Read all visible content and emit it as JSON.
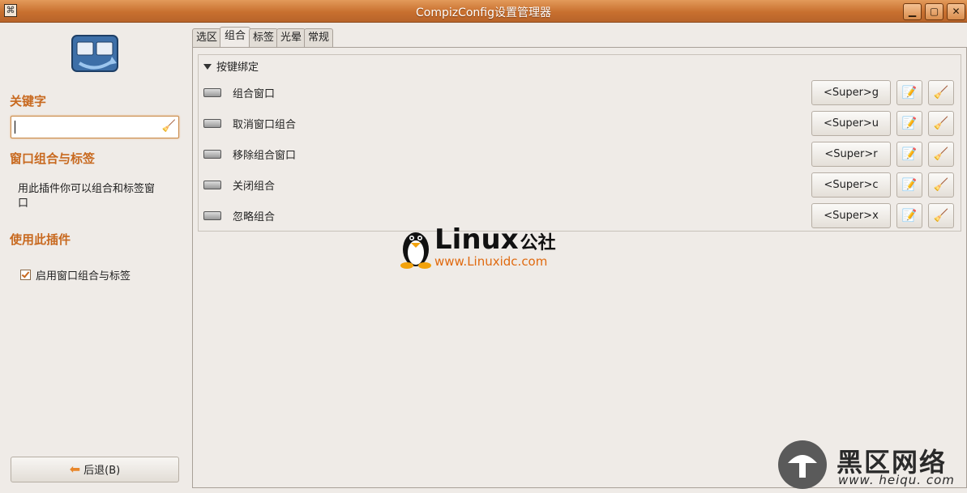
{
  "window": {
    "title": "CompizConfig设置管理器",
    "controls": {
      "minimize": "▁",
      "maximize": "▢",
      "close": "✕"
    }
  },
  "sidebar": {
    "keyword_heading": "关键字",
    "search_value": "",
    "plugin_heading": "窗口组合与标签",
    "plugin_description": "用此插件你可以组合和标签窗口",
    "enable_heading": "使用此插件",
    "enable_checkbox": {
      "label": "启用窗口组合与标签",
      "checked": true
    },
    "back_button": "后退(B)"
  },
  "tabs": [
    {
      "label": "选区",
      "active": false
    },
    {
      "label": "组合",
      "active": true
    },
    {
      "label": "标签",
      "active": false
    },
    {
      "label": "光晕",
      "active": false
    },
    {
      "label": "常规",
      "active": false
    }
  ],
  "group": {
    "title": "按键绑定",
    "bindings": [
      {
        "name": "组合窗口",
        "key": "<Super>g"
      },
      {
        "name": "取消窗口组合",
        "key": "<Super>u"
      },
      {
        "name": "移除组合窗口",
        "key": "<Super>r"
      },
      {
        "name": "关闭组合",
        "key": "<Super>c"
      },
      {
        "name": "忽略组合",
        "key": "<Super>x"
      }
    ]
  },
  "watermarks": {
    "linux_brand": "Linux",
    "linux_cn": "公社",
    "linux_url": "www.Linuxidc.com",
    "heiqu_text": "黑区网络",
    "heiqu_url": "www. heiqu. com"
  },
  "colors": {
    "accent": "#c8691f",
    "titlebar": "#c8702f",
    "background": "#efebe7"
  }
}
